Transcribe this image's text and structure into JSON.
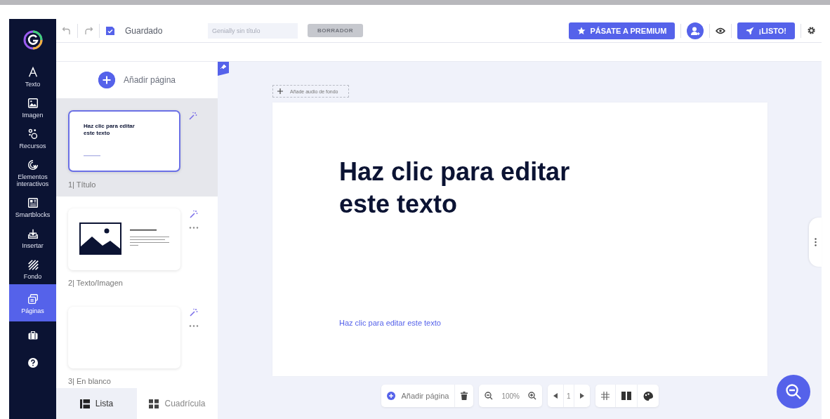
{
  "topbar": {
    "save_status": "Guardado",
    "title_field": {
      "placeholder": "Genially sin título"
    },
    "draft_badge": "BORRADOR",
    "premium_button": "PÁSATE A PREMIUM",
    "ready_button": "¡LISTO!"
  },
  "sidebar": {
    "items": [
      {
        "label": "Texto",
        "kind": "text",
        "selected": false
      },
      {
        "label": "Imagen",
        "kind": "image",
        "selected": false
      },
      {
        "label": "Recursos",
        "kind": "resources",
        "selected": false
      },
      {
        "label": "Elementos interactivos",
        "kind": "interactive",
        "selected": false
      },
      {
        "label": "Smartblocks",
        "kind": "smartblocks",
        "selected": false
      },
      {
        "label": "Insertar",
        "kind": "insert",
        "selected": false
      },
      {
        "label": "Fondo",
        "kind": "background",
        "selected": false
      },
      {
        "label": "Páginas",
        "kind": "pages",
        "selected": true
      }
    ]
  },
  "pages_panel": {
    "add_button": "Añadir página",
    "pages": [
      {
        "label": "1| Título",
        "kind": "title",
        "thumb_title": "Haz clic para editar este texto",
        "selected": true,
        "menu": false
      },
      {
        "label": "2| Texto/Imagen",
        "kind": "text_image",
        "selected": false,
        "menu": true
      },
      {
        "label": "3| En blanco",
        "kind": "blank",
        "selected": false,
        "menu": true
      }
    ],
    "view_tabs": [
      {
        "label": "Lista",
        "kind": "list",
        "selected": true
      },
      {
        "label": "Cuadrícula",
        "kind": "grid",
        "selected": false
      }
    ]
  },
  "canvas": {
    "audio_button": "Añade audio de fondo",
    "slide_title": "Haz clic para editar este texto",
    "slide_subtitle": "Haz clic para editar este texto"
  },
  "bottom_toolbar": {
    "add_page": "Añadir página",
    "zoom": "100%",
    "page_number": "1"
  }
}
